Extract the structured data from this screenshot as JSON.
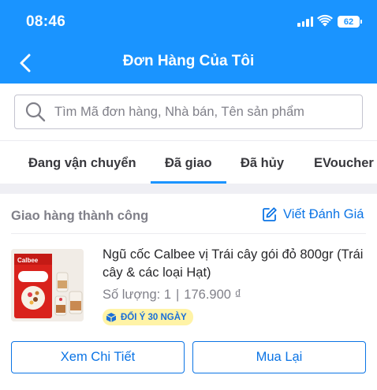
{
  "status_bar": {
    "time": "08:46",
    "battery": "62",
    "icons": [
      "signal-icon",
      "wifi-icon",
      "battery-icon"
    ]
  },
  "header": {
    "back_icon": "chevron-left-icon",
    "title": "Đơn Hàng Của Tôi"
  },
  "search": {
    "icon": "search-icon",
    "placeholder": "Tìm Mã đơn hàng, Nhà bán, Tên sản phẩm",
    "value": ""
  },
  "tabs": [
    {
      "label": "Đang vận chuyển",
      "active": false
    },
    {
      "label": "Đã giao",
      "active": true
    },
    {
      "label": "Đã hủy",
      "active": false
    },
    {
      "label": "EVoucher",
      "active": false
    }
  ],
  "order": {
    "status": "Giao hàng thành công",
    "review_label": "Viết Đánh Giá",
    "review_icon": "edit-icon",
    "product": {
      "image": "product-thumbnail",
      "image_brand": "Calbee",
      "name": "Ngũ cốc Calbee vị Trái cây gói đỏ 800gr (Trái cây & các loại Hạt)",
      "quantity_label": "Số lượng: 1",
      "separator": "|",
      "price": "176.900 ₫",
      "badge": "ĐỔI Ý 30 NGÀY",
      "badge_icon": "box-icon"
    },
    "buttons": {
      "detail": "Xem Chi Tiết",
      "rebuy": "Mua Lại"
    }
  },
  "colors": {
    "header_bg": "#1a94ff",
    "accent": "#0b74e5",
    "badge_bg": "#fff3a6",
    "muted_text": "#808089"
  }
}
